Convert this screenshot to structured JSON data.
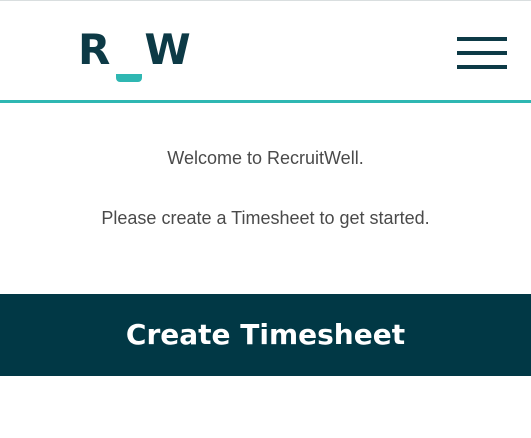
{
  "header": {
    "logo": {
      "left_letter": "R",
      "right_letter": "W"
    },
    "menu_icon": "hamburger-menu-icon"
  },
  "main": {
    "welcome_text": "Welcome to RecruitWell.",
    "instruction_text": "Please create a Timesheet to get started.",
    "create_button_label": "Create Timesheet"
  },
  "colors": {
    "brand_dark": "#013845",
    "brand_teal": "#2fb7b2",
    "text": "#4a4a4a"
  }
}
